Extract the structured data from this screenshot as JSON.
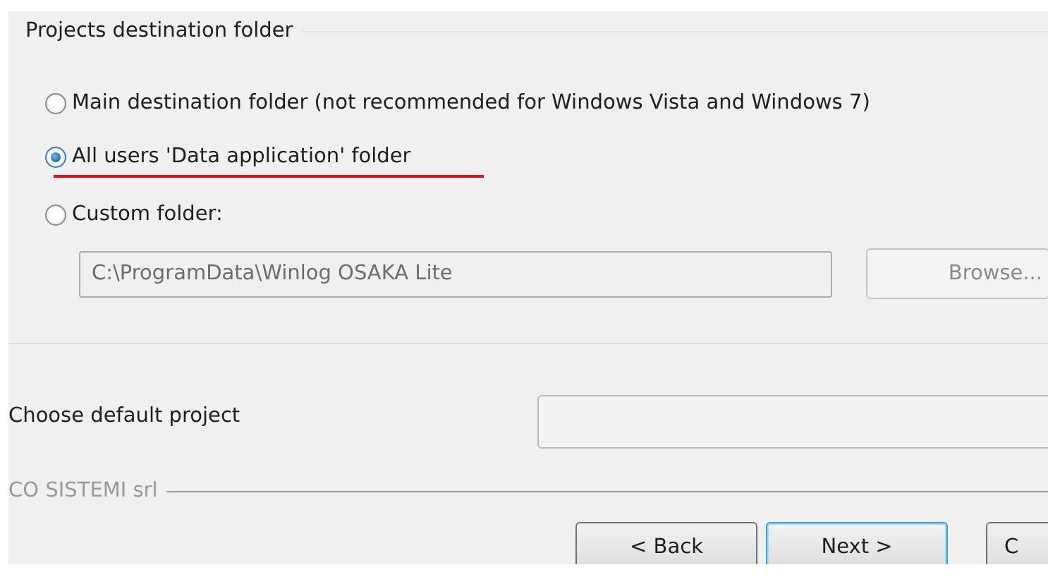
{
  "group": {
    "title": "Projects destination folder"
  },
  "options": [
    {
      "label": "Main destination folder (not recommended for Windows Vista and Windows 7)",
      "selected": false,
      "underlined": false
    },
    {
      "label": "All users 'Data application' folder",
      "selected": true,
      "underlined": true
    },
    {
      "label": "Custom folder:",
      "selected": false,
      "underlined": false
    }
  ],
  "custom_path": {
    "value": "C:\\ProgramData\\Winlog OSAKA Lite",
    "disabled": true
  },
  "browse_button": {
    "label": "Browse...",
    "disabled": true
  },
  "default_project": {
    "label": "Choose default project"
  },
  "company": "CO SISTEMI srl",
  "buttons": [
    {
      "label": "< Back",
      "focused": false
    },
    {
      "label": "Next >",
      "focused": true
    },
    {
      "label": "C",
      "focused": false
    }
  ]
}
